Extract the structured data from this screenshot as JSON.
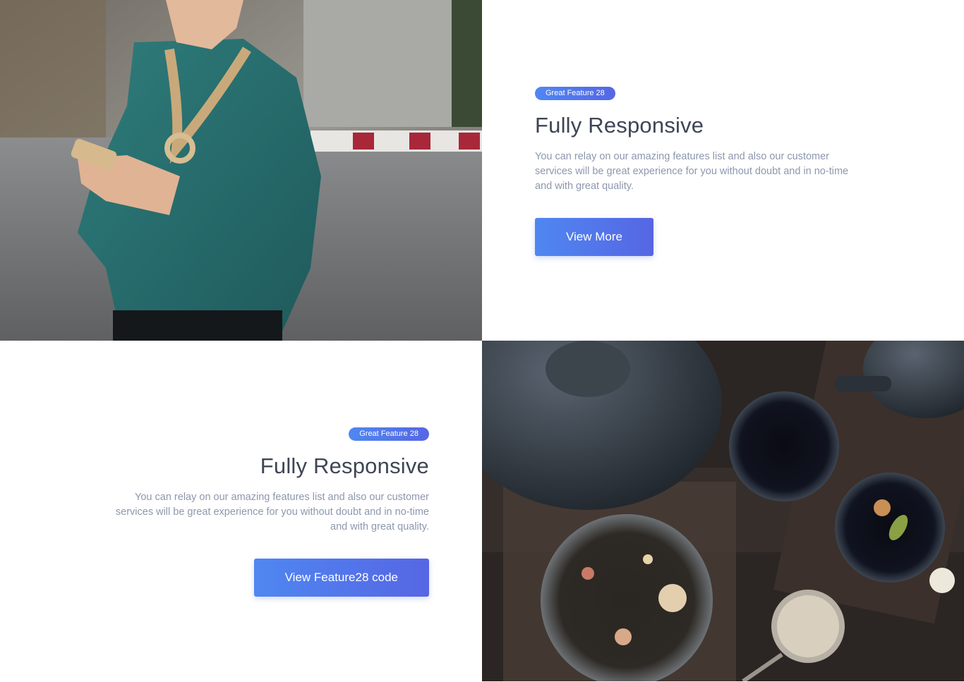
{
  "feature_1": {
    "badge": "Great Feature 28",
    "title": "Fully Responsive",
    "description": "You can relay on our amazing features list and also our customer services will be great experience for you without doubt and in no-time and with great quality.",
    "button_label": "View More"
  },
  "feature_2": {
    "badge": "Great Feature 28",
    "title": "Fully Responsive",
    "description": "You can relay on our amazing features list and also our customer services will be great experience for you without doubt and in no-time and with great quality.",
    "button_label": "View Feature28 code"
  },
  "colors": {
    "accent_start": "#4f87f1",
    "accent_end": "#5666e4",
    "heading": "#3e4555",
    "body_text": "#8d97ad"
  }
}
